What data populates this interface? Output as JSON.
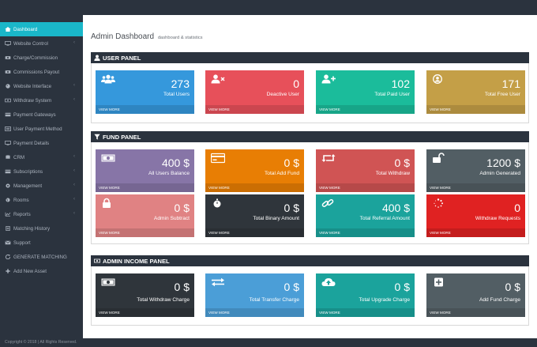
{
  "sidebar": {
    "items": [
      {
        "label": "Dashboard",
        "icon": "home-icon",
        "chevron": false
      },
      {
        "label": "Website Control",
        "icon": "monitor-icon",
        "chevron": true
      },
      {
        "label": "Charge/Commission",
        "icon": "money-icon",
        "chevron": false
      },
      {
        "label": "Commissions Payout",
        "icon": "money-icon",
        "chevron": false
      },
      {
        "label": "Website Interface",
        "icon": "palette-icon",
        "chevron": true
      },
      {
        "label": "Withdraw System",
        "icon": "cash-icon",
        "chevron": true
      },
      {
        "label": "Payment Gateways",
        "icon": "card-icon",
        "chevron": false
      },
      {
        "label": "User Payment Method",
        "icon": "list-icon",
        "chevron": false
      },
      {
        "label": "Payment Details",
        "icon": "monitor-icon",
        "chevron": false
      },
      {
        "label": "CRM",
        "icon": "db-icon",
        "chevron": true
      },
      {
        "label": "Subscriptions",
        "icon": "card-icon",
        "chevron": true
      },
      {
        "label": "Management",
        "icon": "gear-icon",
        "chevron": true
      },
      {
        "label": "Rooms",
        "icon": "globe-icon",
        "chevron": true
      },
      {
        "label": "Reports",
        "icon": "chart-icon",
        "chevron": true
      },
      {
        "label": "Matching History",
        "icon": "doc-icon",
        "chevron": false
      },
      {
        "label": "Support",
        "icon": "support-icon",
        "chevron": false
      },
      {
        "label": "GENERATE MATCHING",
        "icon": "refresh-icon",
        "chevron": false
      },
      {
        "label": "Add New Asset",
        "icon": "plus-icon",
        "chevron": false
      }
    ]
  },
  "header": {
    "title": "Admin Dashboard",
    "subtitle": "dashboard & statistics"
  },
  "user_panel": {
    "title": "USER PANEL",
    "cards": [
      {
        "value": "273",
        "label": "Total Users",
        "footer": "VIEW MORE",
        "color": "#3598dc",
        "icon": "users-icon"
      },
      {
        "value": "0",
        "label": "Deactive User",
        "footer": "VIEW MORE",
        "color": "#e7505a",
        "icon": "user-times-icon"
      },
      {
        "value": "102",
        "label": "Total Paid User",
        "footer": "VIEW MORE",
        "color": "#32c5d2",
        "icon": "user-plus-icon"
      },
      {
        "value": "171",
        "label": "Total Free User",
        "footer": "VIEW MORE",
        "color": "#c49f47",
        "icon": "user-circle-icon"
      }
    ]
  },
  "fund_panel": {
    "title": "FUND PANEL",
    "cards": [
      {
        "value": "400 $",
        "label": "All Users Balance",
        "footer": "VIEW MORE",
        "color": "#8775a7",
        "icon": "cash-icon"
      },
      {
        "value": "0 $",
        "label": "Total Add Fund",
        "footer": "VIEW MORE",
        "color": "#e87e04",
        "icon": "card-icon"
      },
      {
        "value": "0 $",
        "label": "Total Withdraw",
        "footer": "VIEW MORE",
        "color": "#d05454",
        "icon": "retweet-icon"
      },
      {
        "value": "1200 $",
        "label": "Admin Generated",
        "footer": "VIEW MORE",
        "color": "#525e64",
        "icon": "unlock-icon"
      },
      {
        "value": "0 $",
        "label": "Admin Subtract",
        "footer": "VIEW MORE",
        "color": "#e08283",
        "icon": "lock-icon"
      },
      {
        "value": "0 $",
        "label": "Total Binary Amount",
        "footer": "VIEW MORE",
        "color": "#2f353b",
        "icon": "stopwatch-icon"
      },
      {
        "value": "400 $",
        "label": "Total Referral Amount",
        "footer": "VIEW MORE",
        "color": "#1ba39c",
        "icon": "link-icon"
      },
      {
        "value": "0",
        "label": "Withdraw Requests",
        "footer": "VIEW MORE",
        "color": "#e02222",
        "icon": "spinner-icon"
      }
    ]
  },
  "income_panel": {
    "title": "ADMIN INCOME PANEL",
    "cards": [
      {
        "value": "0 $",
        "label": "Total Withdraw Charge",
        "footer": "VIEW MORE",
        "color": "#2f353b",
        "icon": "cash-icon"
      },
      {
        "value": "0 $",
        "label": "Total Transfer Charge",
        "footer": "VIEW MORE",
        "color": "#4b9ed7",
        "icon": "exchange-icon"
      },
      {
        "value": "0 $",
        "label": "Total Upgrade Charge",
        "footer": "VIEW MORE",
        "color": "#1ba39c",
        "icon": "cloud-upload-icon"
      },
      {
        "value": "0 $",
        "label": "Add Fund Charge",
        "footer": "VIEW MORE",
        "color": "#525e64",
        "icon": "plus-square-icon"
      }
    ]
  },
  "footer": {
    "copyright": "Copyright © 2018 | All Rights Reserved."
  }
}
